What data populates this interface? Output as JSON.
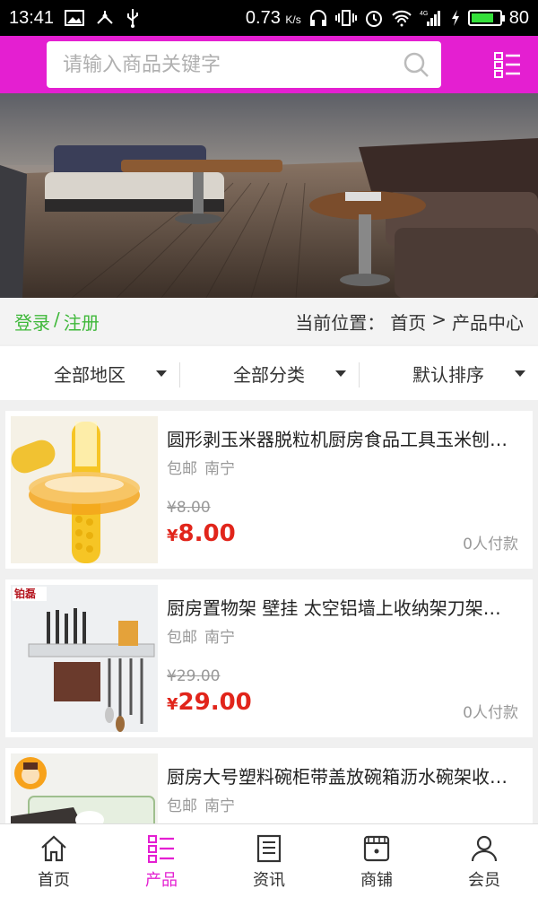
{
  "status_bar": {
    "time": "13:41",
    "net_speed": "0.73",
    "net_unit": "K/s",
    "battery": "80",
    "battery_level": 0.8,
    "network": "4G",
    "icons": [
      "image-icon",
      "usb-tether-icon",
      "usb-icon",
      "headphones-icon",
      "vibrate-icon",
      "alarm-icon",
      "wifi-icon",
      "signal-icon",
      "charging-icon",
      "battery-icon"
    ]
  },
  "colors": {
    "brand": "#e41fd1",
    "green": "#3fb83a",
    "price_red": "#e1251b"
  },
  "search": {
    "placeholder": "请输入商品关键字",
    "icon": "search-icon"
  },
  "menu_icon": "list-menu-icon",
  "breadcrumb_bar": {
    "login": "登录",
    "separator": "/",
    "register": "注册",
    "location_label": "当前位置：",
    "home": "首页",
    "arrow": ">",
    "current": "产品中心"
  },
  "filters": [
    {
      "label": "全部地区"
    },
    {
      "label": "全部分类"
    },
    {
      "label": "默认排序"
    }
  ],
  "products": [
    {
      "title": "圆形剥玉米器脱粒机厨房食品工具玉米刨粒器",
      "shipping": "包邮",
      "city": "南宁",
      "original_price": "¥8.00",
      "currency": "¥",
      "price": "8.00",
      "paid": "0人付款"
    },
    {
      "title": "厨房置物架 壁挂 太空铝墙上收纳架刀架调料架",
      "shipping": "包邮",
      "city": "南宁",
      "original_price": "¥29.00",
      "currency": "¥",
      "price": "29.00",
      "paid": "0人付款",
      "brand_mark": "铂磊"
    },
    {
      "title": "厨房大号塑料碗柜带盖放碗箱沥水碗架收纳盒",
      "shipping": "包邮",
      "city": "南宁"
    }
  ],
  "bottom_nav": [
    {
      "label": "首页",
      "icon": "home-icon",
      "active": false
    },
    {
      "label": "产品",
      "icon": "product-list-icon",
      "active": true
    },
    {
      "label": "资讯",
      "icon": "news-icon",
      "active": false
    },
    {
      "label": "商铺",
      "icon": "shop-icon",
      "active": false
    },
    {
      "label": "会员",
      "icon": "member-icon",
      "active": false
    }
  ]
}
